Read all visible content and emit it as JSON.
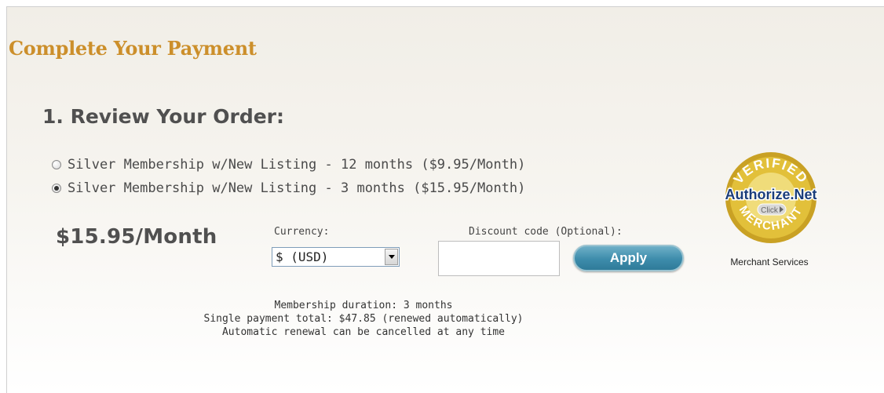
{
  "page": {
    "title": "Complete Your Payment"
  },
  "review": {
    "heading": "1. Review Your Order:",
    "options": [
      {
        "label": "Silver Membership w/New Listing - 12 months ($9.95/Month)",
        "selected": false
      },
      {
        "label": "Silver Membership w/New Listing - 3 months ($15.95/Month)",
        "selected": true
      }
    ],
    "price_display": "$15.95/Month",
    "currency": {
      "label": "Currency:",
      "selected": "$ (USD)"
    },
    "discount": {
      "label": "Discount code (Optional):",
      "value": "",
      "apply_label": "Apply"
    },
    "summary": {
      "duration": "Membership duration: 3 months",
      "total": "Single payment total: $47.85 (renewed automatically)",
      "renewal": "Automatic renewal can be cancelled at any time"
    }
  },
  "seal": {
    "top_text": "VERIFIED",
    "brand": "Authorize.Net",
    "click": "Click",
    "bottom_text": "MERCHANT",
    "caption": "Merchant Services"
  },
  "colors": {
    "title": "#cc8f2b",
    "apply_button": "#3d8cab",
    "seal_gold": "#d8b02b"
  }
}
